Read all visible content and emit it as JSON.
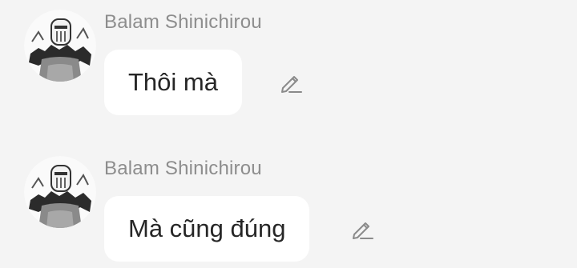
{
  "messages": [
    {
      "author": "Balam Shinichirou",
      "text": "Thôi mà",
      "avatar_icon": "manga-character-avatar-icon",
      "action_icon": "edit-pencil-icon"
    },
    {
      "author": "Balam Shinichirou",
      "text": "Mà cũng đúng",
      "avatar_icon": "manga-character-avatar-icon",
      "action_icon": "edit-pencil-icon"
    }
  ],
  "colors": {
    "background": "#f4f4f4",
    "bubble": "#ffffff",
    "author_text": "#8d8d8d",
    "message_text": "#262626",
    "icon": "#8a8a8a"
  }
}
